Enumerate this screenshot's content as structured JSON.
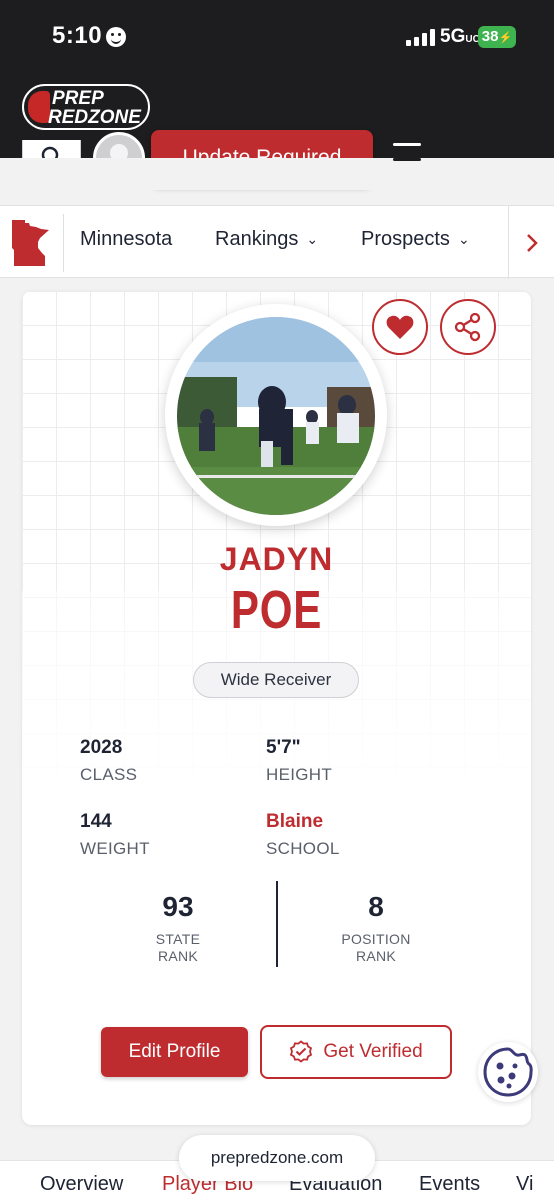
{
  "status_bar": {
    "time": "5:10",
    "network": "5G",
    "network_sup": "UC",
    "battery": "38"
  },
  "header": {
    "logo_top": "PREP",
    "logo_bottom": "REDZONE",
    "update_label": "Update Required"
  },
  "state_nav": {
    "items": [
      {
        "label": "Minnesota",
        "has_chevron": false
      },
      {
        "label": "Rankings",
        "has_chevron": true
      },
      {
        "label": "Prospects",
        "has_chevron": true
      }
    ]
  },
  "player": {
    "first_name": "JADYN",
    "last_name": "POE",
    "position": "Wide Receiver",
    "stats": [
      {
        "value": "2028",
        "label": "CLASS"
      },
      {
        "value": "5'7\"",
        "label": "HEIGHT"
      },
      {
        "value": "144",
        "label": "WEIGHT"
      },
      {
        "value": "Blaine",
        "label": "SCHOOL"
      }
    ],
    "state_rank": {
      "value": "93",
      "label_1": "STATE",
      "label_2": "RANK"
    },
    "position_rank": {
      "value": "8",
      "label_1": "POSITION",
      "label_2": "RANK"
    }
  },
  "actions": {
    "edit_label": "Edit Profile",
    "verify_label": "Get Verified"
  },
  "url": "prepredzone.com",
  "tabs": [
    "Overview",
    "Player Bio",
    "Evaluation",
    "Events",
    "Vi"
  ],
  "colors": {
    "brand_red": "#be2c2f",
    "header_bg": "#1d1d1f",
    "cookie": "#3d3a7a"
  }
}
